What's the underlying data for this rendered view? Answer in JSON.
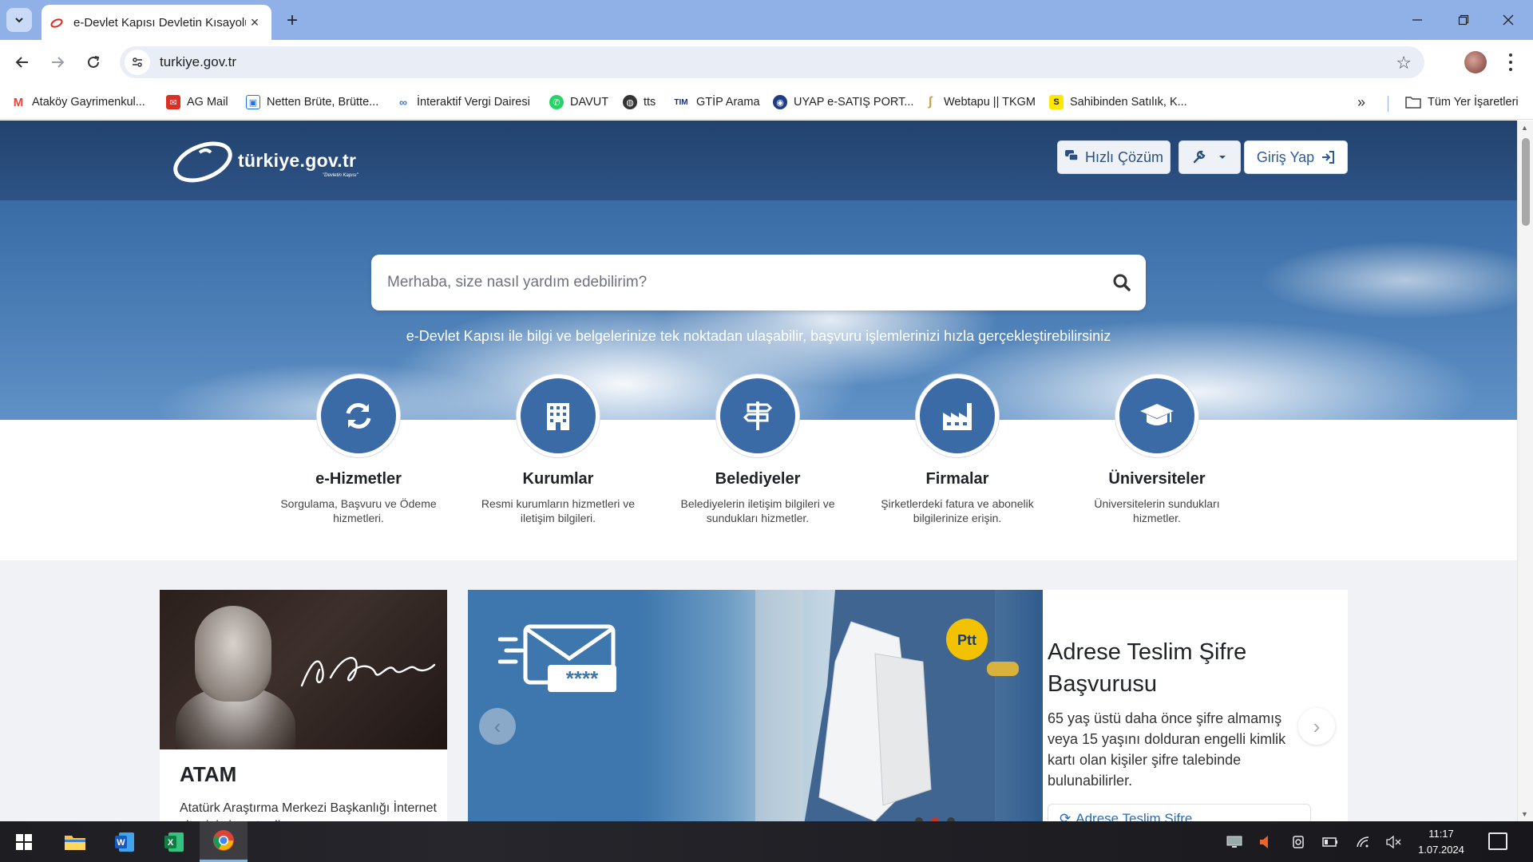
{
  "browser": {
    "tab_title": "e-Devlet Kapısı Devletin Kısayolu",
    "url": "turkiye.gov.tr",
    "new_tab_glyph": "+",
    "tab_close_glyph": "×"
  },
  "bookmarks": [
    {
      "label": "Ataköy Gayrimenkul...",
      "icon": "gmail-icon",
      "color": "#ea4335",
      "glyph": "M"
    },
    {
      "label": "AG Mail",
      "icon": "mail-icon",
      "color": "#d93025",
      "glyph": "✉"
    },
    {
      "label": "Netten Brüte, Brütte...",
      "icon": "calculator-icon",
      "color": "#1a73e8",
      "glyph": "▣"
    },
    {
      "label": "İnteraktif Vergi Dairesi",
      "icon": "gib-icon",
      "color": "#3c78d8",
      "glyph": "∞"
    },
    {
      "label": "DAVUT",
      "icon": "whatsapp-icon",
      "color": "#25d366",
      "glyph": "✆"
    },
    {
      "label": "tts",
      "icon": "globe-icon",
      "color": "#333333",
      "glyph": "◍"
    },
    {
      "label": "GTİP Arama",
      "icon": "tim-icon",
      "color": "#1c2f6b",
      "glyph": "TIM"
    },
    {
      "label": "UYAP e-SATIŞ PORT...",
      "icon": "uyap-icon",
      "color": "#1f3c88",
      "glyph": "◉"
    },
    {
      "label": "Webtapu || TKGM",
      "icon": "tkgm-icon",
      "color": "#c8a04a",
      "glyph": "ʃ"
    },
    {
      "label": "Sahibinden Satılık, K...",
      "icon": "sahibinden-icon",
      "color": "#ffe800",
      "glyph": "S"
    }
  ],
  "bookmarks_all": "Tüm Yer İşaretleri",
  "bookmarks_more": "»",
  "site": {
    "logo_text": "türkiye.gov.tr",
    "logo_sub": "\"Devletin Kapısı\"",
    "hizli_cozum": "Hızlı Çözüm",
    "giris_yap": "Giriş Yap",
    "search_placeholder": "Merhaba, size nasıl yardım edebilirim?",
    "tagline": "e-Devlet Kapısı ile bilgi ve belgelerinize tek noktadan ulaşabilir, başvuru işlemlerinizi hızla gerçekleştirebilirsiniz",
    "categories": [
      {
        "title": "e-Hizmetler",
        "desc": "Sorgulama, Başvuru ve Ödeme hizmetleri.",
        "icon": "refresh-icon"
      },
      {
        "title": "Kurumlar",
        "desc": "Resmi kurumların hizmetleri ve iletişim bilgileri.",
        "icon": "building-icon"
      },
      {
        "title": "Belediyeler",
        "desc": "Belediyelerin iletişim bilgileri ve sundukları hizmetler.",
        "icon": "signpost-icon"
      },
      {
        "title": "Firmalar",
        "desc": "Şirketlerdeki fatura ve abonelik bilgilerinize erişin.",
        "icon": "factory-icon"
      },
      {
        "title": "Üniversiteler",
        "desc": "Üniversitelerin sundukları hizmetler.",
        "icon": "graduation-cap-icon"
      }
    ],
    "atam": {
      "title": "ATAM",
      "desc": "Atatürk Araştırma Merkezi Başkanlığı İnternet sitesini ziyaret edin."
    },
    "slide": {
      "title": "Adrese Teslim Şifre Başvurusu",
      "desc": "65 yaş üstü daha önce şifre almamış veya 15 yaşını dolduran engelli kimlik kartı olan kişiler şifre talebinde bulunabilirler.",
      "link": "Adrese Teslim Şifre",
      "envelope_code": "****",
      "badge": "Ptt"
    }
  },
  "taskbar": {
    "time": "11:17",
    "date": "1.07.2024"
  },
  "colors": {
    "brand_blue": "#3a6ba6",
    "header_dark": "#22426d",
    "active_dot": "#c0392b"
  }
}
